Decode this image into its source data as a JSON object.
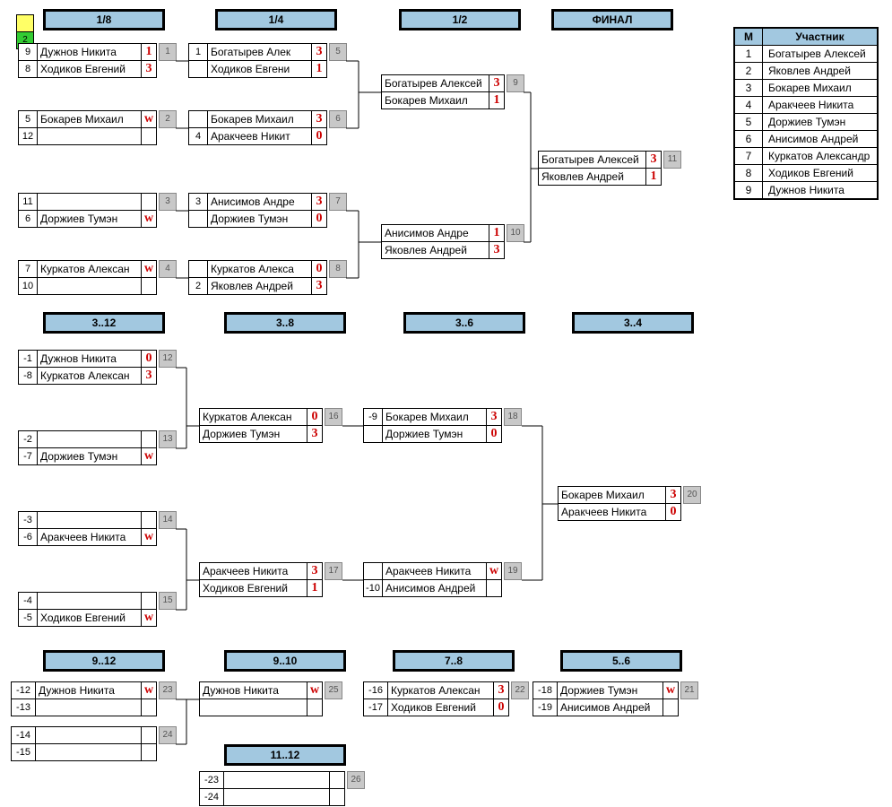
{
  "corner": {
    "badge": "2"
  },
  "headers": {
    "1_8": "1/8",
    "1_4": "1/4",
    "1_2": "1/2",
    "final": "ФИНАЛ",
    "3_12": "3..12",
    "3_8": "3..8",
    "3_6": "3..6",
    "3_4": "3..4",
    "9_12": "9..12",
    "9_10": "9..10",
    "11_12": "11..12",
    "7_8": "7..8",
    "5_6": "5..6"
  },
  "participants": {
    "head_m": "М",
    "head_name": "Участник",
    "rows": [
      {
        "n": "1",
        "name": "Богатырев Алексей"
      },
      {
        "n": "2",
        "name": "Яковлев Андрей"
      },
      {
        "n": "3",
        "name": "Бокарев Михаил"
      },
      {
        "n": "4",
        "name": "Аракчеев Никита"
      },
      {
        "n": "5",
        "name": "Доржиев Тумэн"
      },
      {
        "n": "6",
        "name": "Анисимов Андрей"
      },
      {
        "n": "7",
        "name": "Куркатов Александр"
      },
      {
        "n": "8",
        "name": "Ходиков Евгений"
      },
      {
        "n": "9",
        "name": "Дужнов Никита"
      }
    ]
  },
  "matches": {
    "m1": {
      "num": "1",
      "p1": {
        "seed": "9",
        "name": "Дужнов Никита",
        "score": "1"
      },
      "p2": {
        "seed": "8",
        "name": "Ходиков Евгений",
        "score": "3"
      }
    },
    "m2": {
      "num": "2",
      "p1": {
        "seed": "5",
        "name": "Бокарев Михаил",
        "score": "w"
      },
      "p2": {
        "seed": "12",
        "name": "",
        "score": ""
      }
    },
    "m3": {
      "num": "3",
      "p1": {
        "seed": "11",
        "name": "",
        "score": ""
      },
      "p2": {
        "seed": "6",
        "name": "Доржиев Тумэн",
        "score": "w"
      }
    },
    "m4": {
      "num": "4",
      "p1": {
        "seed": "7",
        "name": "Куркатов Алексан",
        "score": "w"
      },
      "p2": {
        "seed": "10",
        "name": "",
        "score": ""
      }
    },
    "m5": {
      "num": "5",
      "p1": {
        "seed": "1",
        "name": "Богатырев Алек",
        "score": "3"
      },
      "p2": {
        "seed": "",
        "name": "Ходиков Евгени",
        "score": "1"
      }
    },
    "m6": {
      "num": "6",
      "p1": {
        "seed": "",
        "name": "Бокарев Михаил",
        "score": "3"
      },
      "p2": {
        "seed": "4",
        "name": "Аракчеев Никит",
        "score": "0"
      }
    },
    "m7": {
      "num": "7",
      "p1": {
        "seed": "3",
        "name": "Анисимов Андре",
        "score": "3"
      },
      "p2": {
        "seed": "",
        "name": "Доржиев Тумэн",
        "score": "0"
      }
    },
    "m8": {
      "num": "8",
      "p1": {
        "seed": "",
        "name": "Куркатов Алекса",
        "score": "0"
      },
      "p2": {
        "seed": "2",
        "name": "Яковлев Андрей",
        "score": "3"
      }
    },
    "m9": {
      "num": "9",
      "p1": {
        "name": "Богатырев Алексей",
        "score": "3"
      },
      "p2": {
        "name": "Бокарев Михаил",
        "score": "1"
      }
    },
    "m10": {
      "num": "10",
      "p1": {
        "name": "Анисимов Андре",
        "score": "1"
      },
      "p2": {
        "name": "Яковлев Андрей",
        "score": "3"
      }
    },
    "m11": {
      "num": "11",
      "p1": {
        "name": "Богатырев Алексей",
        "score": "3"
      },
      "p2": {
        "name": "Яковлев Андрей",
        "score": "1"
      }
    },
    "m12": {
      "num": "12",
      "p1": {
        "seed": "-1",
        "name": "Дужнов Никита",
        "score": "0"
      },
      "p2": {
        "seed": "-8",
        "name": "Куркатов Алексан",
        "score": "3"
      }
    },
    "m13": {
      "num": "13",
      "p1": {
        "seed": "-2",
        "name": "",
        "score": ""
      },
      "p2": {
        "seed": "-7",
        "name": "Доржиев Тумэн",
        "score": "w"
      }
    },
    "m14": {
      "num": "14",
      "p1": {
        "seed": "-3",
        "name": "",
        "score": ""
      },
      "p2": {
        "seed": "-6",
        "name": "Аракчеев Никита",
        "score": "w"
      }
    },
    "m15": {
      "num": "15",
      "p1": {
        "seed": "-4",
        "name": "",
        "score": ""
      },
      "p2": {
        "seed": "-5",
        "name": "Ходиков Евгений",
        "score": "w"
      }
    },
    "m16": {
      "num": "16",
      "p1": {
        "name": "Куркатов Алексан",
        "score": "0"
      },
      "p2": {
        "name": "Доржиев Тумэн",
        "score": "3"
      }
    },
    "m17": {
      "num": "17",
      "p1": {
        "name": "Аракчеев Никита",
        "score": "3"
      },
      "p2": {
        "name": "Ходиков Евгений",
        "score": "1"
      }
    },
    "m18": {
      "num": "18",
      "p1": {
        "seed": "-9",
        "name": "Бокарев Михаил",
        "score": "3"
      },
      "p2": {
        "seed": "",
        "name": "Доржиев Тумэн",
        "score": "0"
      }
    },
    "m19": {
      "num": "19",
      "p1": {
        "seed": "",
        "name": "Аракчеев Никита",
        "score": "w"
      },
      "p2": {
        "seed": "-10",
        "name": "Анисимов Андрей",
        "score": ""
      }
    },
    "m20": {
      "num": "20",
      "p1": {
        "name": "Бокарев Михаил",
        "score": "3"
      },
      "p2": {
        "name": "Аракчеев Никита",
        "score": "0"
      }
    },
    "m23": {
      "num": "23",
      "p1": {
        "seed": "-12",
        "name": "Дужнов Никита",
        "score": "w"
      },
      "p2": {
        "seed": "-13",
        "name": "",
        "score": ""
      }
    },
    "m24": {
      "num": "24",
      "p1": {
        "seed": "-14",
        "name": "",
        "score": ""
      },
      "p2": {
        "seed": "-15",
        "name": "",
        "score": ""
      }
    },
    "m25": {
      "num": "25",
      "p1": {
        "name": "Дужнов Никита",
        "score": "w"
      },
      "p2": {
        "name": "",
        "score": ""
      }
    },
    "m26": {
      "num": "26",
      "p1": {
        "seed": "-23",
        "name": "",
        "score": ""
      },
      "p2": {
        "seed": "-24",
        "name": "",
        "score": ""
      }
    },
    "m22": {
      "num": "22",
      "p1": {
        "seed": "-16",
        "name": "Куркатов Алексан",
        "score": "3"
      },
      "p2": {
        "seed": "-17",
        "name": "Ходиков Евгений",
        "score": "0"
      }
    },
    "m21": {
      "num": "21",
      "p1": {
        "seed": "-18",
        "name": "Доржиев Тумэн",
        "score": "w"
      },
      "p2": {
        "seed": "-19",
        "name": "Анисимов Андрей",
        "score": ""
      }
    }
  }
}
